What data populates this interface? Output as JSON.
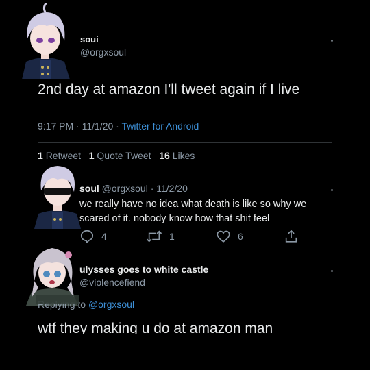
{
  "tweet": {
    "name": "soui",
    "handle": "@orgxsoul",
    "text": "2nd day at amazon I'll tweet again if I live",
    "time": "9:17 PM",
    "date": "11/1/20",
    "client": "Twitter for Android",
    "separator": "·"
  },
  "stats": {
    "retweets_count": "1",
    "retweets_label": "Retweet",
    "quotes_count": "1",
    "quotes_label": "Quote Tweet",
    "likes_count": "16",
    "likes_label": "Likes"
  },
  "reply1": {
    "name": "soul",
    "handle_date": "@orgxsoul · 11/2/20",
    "text_line1": "we really have no idea what death is like so why we",
    "text_line2": "scared of it. nobody know how that shit feel",
    "replies": "4",
    "retweets": "1",
    "likes": "6"
  },
  "reply2": {
    "name": "ulysses goes to white castle",
    "handle": "@violencefiend",
    "replying_prefix": "Replying to",
    "replying_to": "@orgxsoul",
    "text": "wtf they making u do at amazon man"
  },
  "icons": {
    "menu": "more-dot-icon",
    "reply": "reply-icon",
    "retweet": "retweet-icon",
    "like": "heart-icon",
    "share": "share-icon"
  },
  "colors": {
    "background": "#000000",
    "link": "#3d8fd6",
    "muted": "#8b98a5",
    "text": "#e7e9ea"
  }
}
